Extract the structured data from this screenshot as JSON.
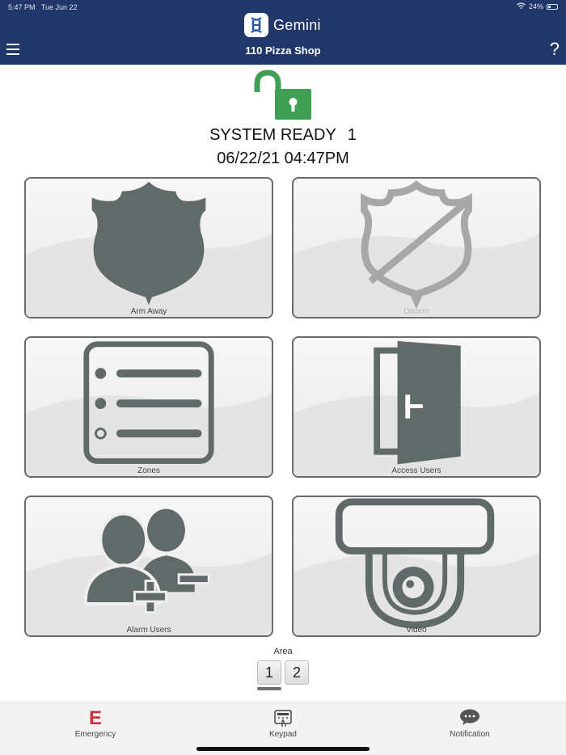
{
  "status_bar": {
    "time": "5:47 PM",
    "date": "Tue Jun 22",
    "battery": "24%"
  },
  "header": {
    "app_name": "Gemini",
    "site_name": "110 Pizza Shop",
    "help": "?"
  },
  "system": {
    "status": "SYSTEM READY",
    "number": "1",
    "datetime": "06/22/21 04:47PM",
    "lock_state": "unlocked",
    "lock_color": "#3f9f55"
  },
  "tiles": [
    {
      "label": "Arm Away",
      "icon": "police-shield-icon",
      "enabled": true
    },
    {
      "label": "Disarm",
      "icon": "disarm-shield-icon",
      "enabled": false
    },
    {
      "label": "Zones",
      "icon": "zones-list-icon",
      "enabled": true
    },
    {
      "label": "Access Users",
      "icon": "open-door-icon",
      "enabled": true
    },
    {
      "label": "Alarm Users",
      "icon": "users-add-remove-icon",
      "enabled": true
    },
    {
      "label": "Video",
      "icon": "dome-camera-icon",
      "enabled": true
    }
  ],
  "area": {
    "label": "Area",
    "options": [
      "1",
      "2"
    ],
    "selected": "1"
  },
  "bottom_nav": [
    {
      "label": "Emergency",
      "icon": "E",
      "color": "#d32f3a"
    },
    {
      "label": "Keypad",
      "icon": "keypad-icon"
    },
    {
      "label": "Notification",
      "icon": "chat-bubble-icon"
    }
  ],
  "colors": {
    "header": "#213769",
    "icon": "#5f6a69"
  }
}
